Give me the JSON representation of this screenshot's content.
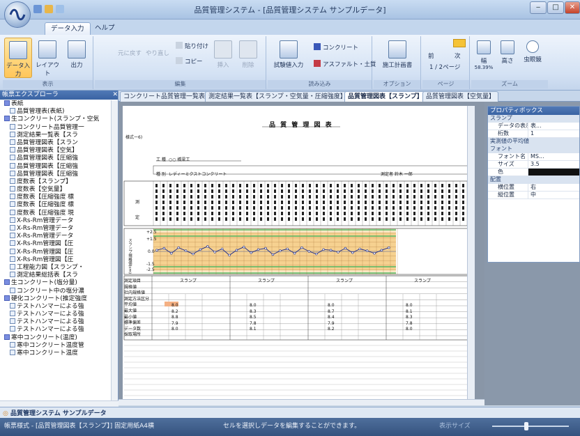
{
  "window": {
    "title": "品質管理システム - [品質管理システム サンプルデータ]",
    "min": "‒",
    "max": "□",
    "close": "✕"
  },
  "ribbon": {
    "tabs": [
      "データ入力",
      "ヘルプ"
    ],
    "groups": [
      {
        "label": "表示",
        "buttons": [
          "データ入力",
          "レイアウト",
          "出力"
        ]
      },
      {
        "label": "編集",
        "buttons": [
          "元に戻す",
          "やり直し",
          "貼り付け",
          "コピー",
          "挿入",
          "削除"
        ]
      },
      {
        "label": "読み込み",
        "buttons": [
          "試験値入力",
          "コンクリート",
          "アスファルト・土質"
        ]
      },
      {
        "label": "オプション",
        "buttons": [
          "施工計画書"
        ]
      },
      {
        "label": "ページ",
        "buttons": [
          "前",
          "次"
        ],
        "page": "1 / 2ページ"
      },
      {
        "label": "ズーム",
        "buttons": [
          "幅",
          "高さ",
          "虫眼鏡"
        ],
        "zoom": "58.39%"
      }
    ]
  },
  "explorer": {
    "title": "帳票エクスプローラ",
    "items": [
      {
        "label": "表紙",
        "folder": true
      },
      {
        "label": "品質管理表(表紙)",
        "folder": false
      },
      {
        "label": "生コンクリート(スランプ・空気",
        "folder": true
      },
      {
        "label": "コンクリート品質管理一",
        "folder": false
      },
      {
        "label": "測定結果一覧表【スラ",
        "folder": false
      },
      {
        "label": "品質管理図表【スラン",
        "folder": false
      },
      {
        "label": "品質管理図表【空気】",
        "folder": false
      },
      {
        "label": "品質管理図表【圧縮強",
        "folder": false
      },
      {
        "label": "品質管理図表【圧縮強",
        "folder": false
      },
      {
        "label": "品質管理図表【圧縮強",
        "folder": false
      },
      {
        "label": "度数表【スランプ】",
        "folder": false
      },
      {
        "label": "度数表【空気量】",
        "folder": false
      },
      {
        "label": "度数表【圧縮強度 標",
        "folder": false
      },
      {
        "label": "度数表【圧縮強度 標",
        "folder": false
      },
      {
        "label": "度数表【圧縮強度 現",
        "folder": false
      },
      {
        "label": "X-Rs-Rm管理データ",
        "folder": false
      },
      {
        "label": "X-Rs-Rm管理データ",
        "folder": false
      },
      {
        "label": "X-Rs-Rm管理データ",
        "folder": false
      },
      {
        "label": "X-Rs-Rm管理図【圧",
        "folder": false
      },
      {
        "label": "X-Rs-Rm管理図【圧",
        "folder": false
      },
      {
        "label": "X-Rs-Rm管理図【圧",
        "folder": false
      },
      {
        "label": "工程能力図【スランプ・",
        "folder": false
      },
      {
        "label": "測定結果総括表【スラ",
        "folder": false
      },
      {
        "label": "生コンクリート(塩分量)",
        "folder": true
      },
      {
        "label": "コンクリート中の塩分濃",
        "folder": false
      },
      {
        "label": "硬化コンクリート(推定強度",
        "folder": true
      },
      {
        "label": "テストハンマーによる強",
        "folder": false
      },
      {
        "label": "テストハンマーによる強",
        "folder": false
      },
      {
        "label": "テストハンマーによる強",
        "folder": false
      },
      {
        "label": "テストハンマーによる強",
        "folder": false
      },
      {
        "label": "寒中コンクリート(温度)",
        "folder": true
      },
      {
        "label": "寒中コンクリート温度管",
        "folder": false
      },
      {
        "label": "寒中コンクリート温度",
        "folder": false
      }
    ]
  },
  "doctabs": [
    "コンクリート品質管理一覧表",
    "測定結果一覧表【スランプ・空気量・圧縮強度】",
    "品質管理図表【スランプ】",
    "品質管理図表【空気量】"
  ],
  "sheet": {
    "code": "様式ー6)",
    "title": "品 質 管 理 図 表",
    "row1_label": "工 種",
    "row1_value": "○○ 橋梁工",
    "row2_label": "種 別",
    "row2_value": "レディーミクストコンクリート",
    "inspector": "測定者 鈴木 一郎",
    "header_left_top": "測",
    "header_left_bottom": "定",
    "chart_axis_label": "スランプ規格値(cm)",
    "y_ticks": [
      "+2.5",
      "+1.5",
      "0.0",
      "-1.5",
      "-2.5"
    ],
    "stats_block_label": "スランプ",
    "stats_rows": [
      "測定項目",
      "規格値",
      "社内規格値",
      "測定方法区分",
      "平均値",
      "最大値",
      "最小値",
      "標準偏差",
      "データ数",
      "採取場所"
    ],
    "block_values": [
      [
        "8.0",
        "8.2",
        "8.8",
        "7.9",
        "8.0"
      ],
      [
        "8.0",
        "8.3",
        "8.5",
        "7.8",
        "8.1"
      ],
      [
        "8.0",
        "8.7",
        "8.4",
        "7.9",
        "8.2"
      ],
      [
        "8.0",
        "8.1",
        "8.3",
        "7.8",
        "8.0"
      ]
    ]
  },
  "properties": {
    "title": "プロパティボックス",
    "rows": [
      {
        "cat": "スランプ"
      },
      {
        "k": "データの表示設定",
        "v": "表..."
      },
      {
        "k": "桁数",
        "v": "1"
      },
      {
        "cat": "実測値の平均値"
      },
      {
        "cat": "フォント"
      },
      {
        "k": "フォント名",
        "v": "MS..."
      },
      {
        "k": "サイズ",
        "v": "3.5"
      },
      {
        "k": "色",
        "v": ""
      },
      {
        "cat": "配置"
      },
      {
        "k": "横位置",
        "v": "右"
      },
      {
        "k": "縦位置",
        "v": "中"
      }
    ]
  },
  "bottom_tab": "品質管理システム サンプルデータ",
  "status": {
    "left": "帳票様式 - [品質管理図表【スランプ】] 固定用紙A4横",
    "message": "セルを選択しデータを編集することができます。",
    "size_label": "表示サイズ"
  },
  "colors": {
    "accent": "#3a63a3",
    "chart_band": "#f2c97a",
    "chart_green": "#35b35a",
    "chart_line": "#1b2a8a"
  }
}
